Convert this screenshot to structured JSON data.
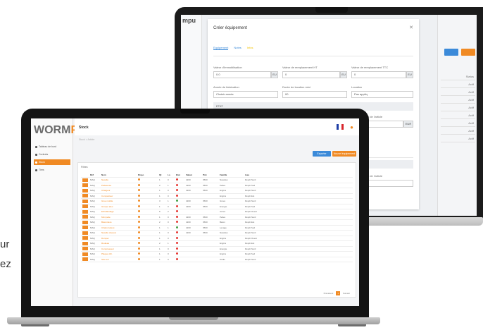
{
  "edge_text": {
    "line1": "ur",
    "line2": "ez"
  },
  "back_app": {
    "logo": "mpu",
    "dialog_title": "Créer équipement",
    "tabs": [
      "Equipement",
      "Notes",
      "Infos"
    ],
    "fields": [
      {
        "label": "Valeur d'immobilisation",
        "value": "0.0",
        "addon": "EU"
      },
      {
        "label": "Valeur de remplacement HT",
        "value": "0",
        "addon": "EU"
      },
      {
        "label": "Valeur de remplacement TTC",
        "value": "0",
        "addon": "EU"
      },
      {
        "label": "Année de fabrication",
        "value": "Choisir année"
      },
      {
        "label": "Durée de location mini",
        "value": "00"
      },
      {
        "label": "Location",
        "value": "Pas appliq"
      },
      {
        "label": "Règlement de location",
        "value": ""
      },
      {
        "label": "Etat du stock",
        "value": ""
      },
      {
        "label": "Valeur d'achat de l'article",
        "value": "0.0",
        "addon": "EUR"
      }
    ],
    "band_label": "ETAT",
    "side_cells": [
      "Status",
      "Actif",
      "Actif",
      "Actif",
      "Actif",
      "Actif",
      "Actif",
      "Actif",
      "Actif"
    ]
  },
  "front_app": {
    "logo_main": "WORM",
    "logo_accent": "PE",
    "menu": [
      {
        "label": "Tableau de bord",
        "active": false
      },
      {
        "label": "Contrats",
        "active": false
      },
      {
        "label": "Stock",
        "active": true
      },
      {
        "label": "Tiers",
        "active": false
      }
    ],
    "page_title": "Stock",
    "breadcrumb": "Stock > Article",
    "flag_colors": [
      "#1f3fa6",
      "#ffffff",
      "#d8262c"
    ],
    "btn_blue": "Exporter",
    "btn_orange": "Nouvel équipement",
    "filter_label": "Filtres",
    "columns": [
      "",
      "Réf",
      "Nom",
      "Dispo",
      "Qt",
      "Lo",
      "Etat",
      "Valeur",
      "Prix",
      "Famille",
      "Lieu"
    ],
    "rows": [
      [
        "MAQ",
        "Nacelle",
        "",
        "1",
        "0",
        "4200",
        "3500",
        "Nacelles",
        "Dépôt Nord"
      ],
      [
        "MAQ",
        "Pelleteuse",
        "",
        "2",
        "1",
        "4200",
        "3500",
        "Pelles",
        "Dépôt Sud"
      ],
      [
        "MAQ",
        "Chargeur",
        "",
        "1",
        "0",
        "4200",
        "3500",
        "Engins",
        "Dépôt Nord"
      ],
      [
        "MAQ",
        "Compacteur",
        "",
        "1",
        "0",
        "",
        "",
        "Engins",
        "Dépôt Est"
      ],
      [
        "MAQ",
        "Grue mobile",
        "",
        "3",
        "1",
        "4200",
        "3500",
        "Grues",
        "Dépôt Nord"
      ],
      [
        "MAQ",
        "Groupe élec.",
        "",
        "1",
        "0",
        "4200",
        "3500",
        "Energie",
        "Dépôt Sud"
      ],
      [
        "MAQ",
        "Echafaudage",
        "",
        "5",
        "2",
        "",
        "",
        "Acces",
        "Dépôt Ouest"
      ],
      [
        "MAQ",
        "Mini pelle",
        "",
        "1",
        "0",
        "4200",
        "3500",
        "Pelles",
        "Dépôt Nord"
      ],
      [
        "MAQ",
        "Bétonnière",
        "",
        "2",
        "0",
        "4200",
        "3500",
        "Béton",
        "Dépôt Est"
      ],
      [
        "MAQ",
        "Chariot télesc.",
        "",
        "1",
        "1",
        "4200",
        "3500",
        "Levage",
        "Dépôt Sud"
      ],
      [
        "MAQ",
        "Nacelle ciseaux",
        "",
        "1",
        "0",
        "4200",
        "3500",
        "Nacelles",
        "Dépôt Nord"
      ],
      [
        "MAQ",
        "Dumper",
        "",
        "1",
        "0",
        "",
        "",
        "Engins",
        "Dépôt Ouest"
      ],
      [
        "MAQ",
        "Rouleau",
        "",
        "2",
        "1",
        "",
        "",
        "Engins",
        "Dépôt Est"
      ],
      [
        "MAQ",
        "Compresseur",
        "",
        "1",
        "0",
        "",
        "",
        "Energie",
        "Dépôt Nord"
      ],
      [
        "MAQ",
        "Plaque vibr.",
        "",
        "1",
        "0",
        "",
        "",
        "Engins",
        "Dépôt Sud"
      ],
      [
        "MAQ",
        "Scie sol",
        "",
        "1",
        "0",
        "",
        "",
        "Outils",
        "Dépôt Nord"
      ]
    ],
    "status_colors": [
      "#e53935",
      "#e53935",
      "#e53935",
      "#e53935",
      "#43a047",
      "#e53935",
      "#e53935",
      "#e53935",
      "#e53935",
      "#43a047",
      "#e53935",
      "#e53935",
      "#e53935",
      "#e53935",
      "#e53935",
      "#e53935"
    ],
    "pager": {
      "prev": "Précédent",
      "current": "1",
      "next": "Suivant"
    }
  },
  "accent_orange": "#f08a24",
  "accent_blue": "#3b8ad9"
}
